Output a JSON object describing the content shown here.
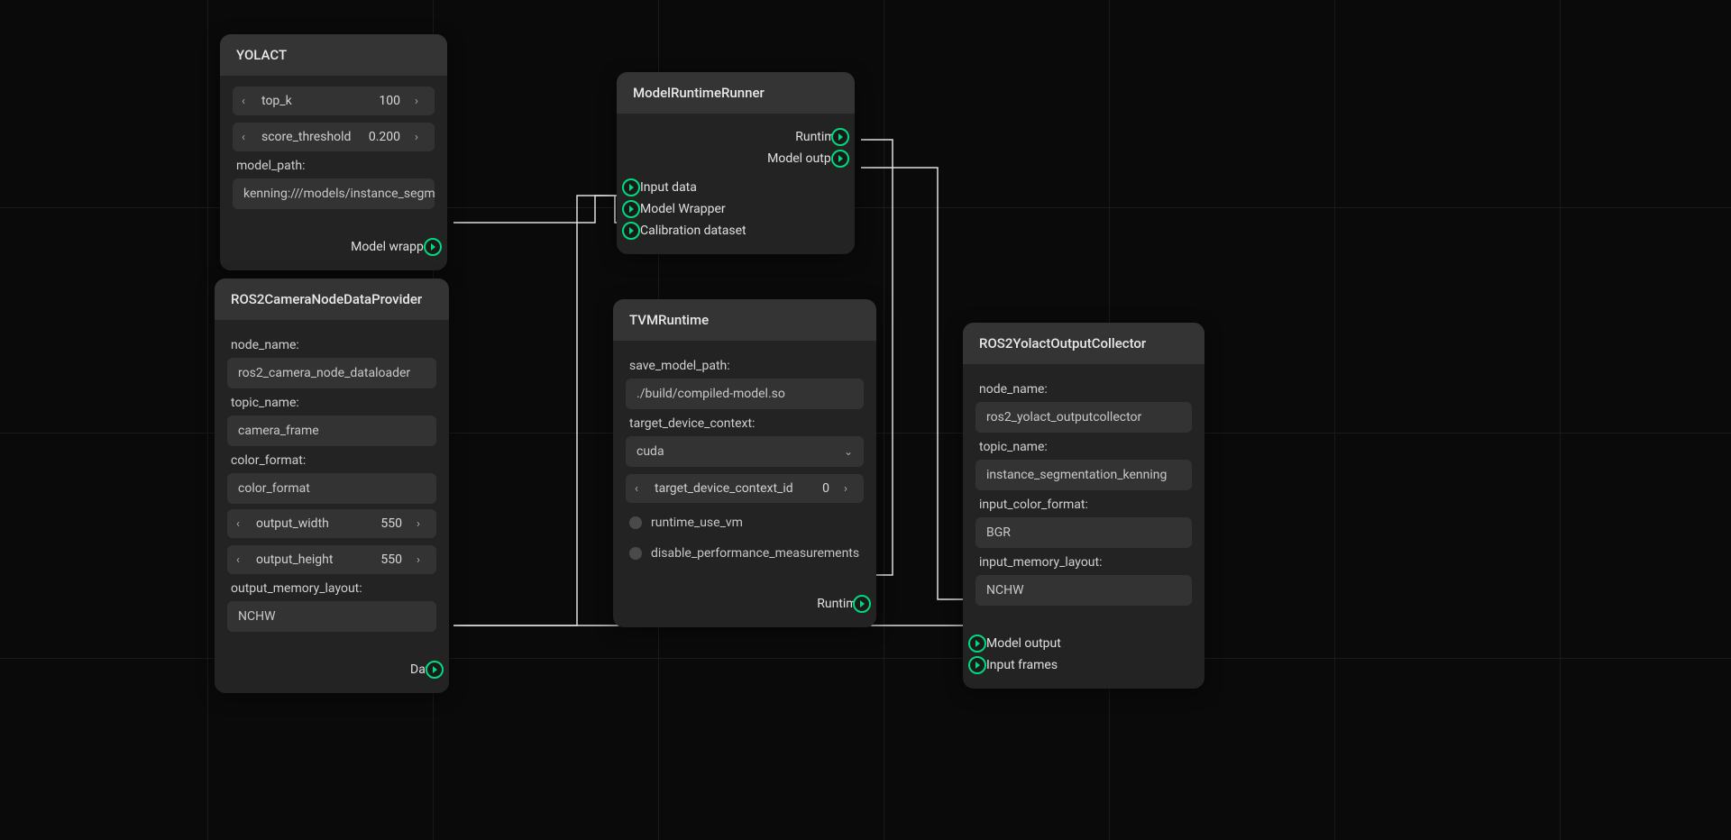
{
  "nodes": {
    "yolact": {
      "title": "YOLACT",
      "top_k": {
        "label": "top_k",
        "value": "100"
      },
      "score_threshold": {
        "label": "score_threshold",
        "value": "0.200"
      },
      "model_path": {
        "label": "model_path:",
        "value": "kenning:///models/instance_segm"
      },
      "out_port": "Model wrapper"
    },
    "provider": {
      "title": "ROS2CameraNodeDataProvider",
      "node_name": {
        "label": "node_name:",
        "value": "ros2_camera_node_dataloader"
      },
      "topic_name": {
        "label": "topic_name:",
        "value": "camera_frame"
      },
      "color_format": {
        "label": "color_format:",
        "value": "color_format"
      },
      "output_width": {
        "label": "output_width",
        "value": "550"
      },
      "output_height": {
        "label": "output_height",
        "value": "550"
      },
      "output_memory_layout": {
        "label": "output_memory_layout:",
        "value": "NCHW"
      },
      "out_port": "Data"
    },
    "runner": {
      "title": "ModelRuntimeRunner",
      "out_runtime": "Runtime",
      "out_model_output": "Model output",
      "in_input_data": "Input data",
      "in_model_wrapper": "Model Wrapper",
      "in_calibration": "Calibration dataset"
    },
    "tvm": {
      "title": "TVMRuntime",
      "save_model_path": {
        "label": "save_model_path:",
        "value": "./build/compiled-model.so"
      },
      "target_device_context": {
        "label": "target_device_context:",
        "value": "cuda"
      },
      "target_device_context_id": {
        "label": "target_device_context_id",
        "value": "0"
      },
      "runtime_use_vm": "runtime_use_vm",
      "disable_perf": "disable_performance_measurements",
      "out_port": "Runtime"
    },
    "collector": {
      "title": "ROS2YolactOutputCollector",
      "node_name": {
        "label": "node_name:",
        "value": "ros2_yolact_outputcollector"
      },
      "topic_name": {
        "label": "topic_name:",
        "value": "instance_segmentation_kenning"
      },
      "input_color_format": {
        "label": "input_color_format:",
        "value": "BGR"
      },
      "input_memory_layout": {
        "label": "input_memory_layout:",
        "value": "NCHW"
      },
      "in_model_output": "Model output",
      "in_input_frames": "Input frames"
    }
  }
}
